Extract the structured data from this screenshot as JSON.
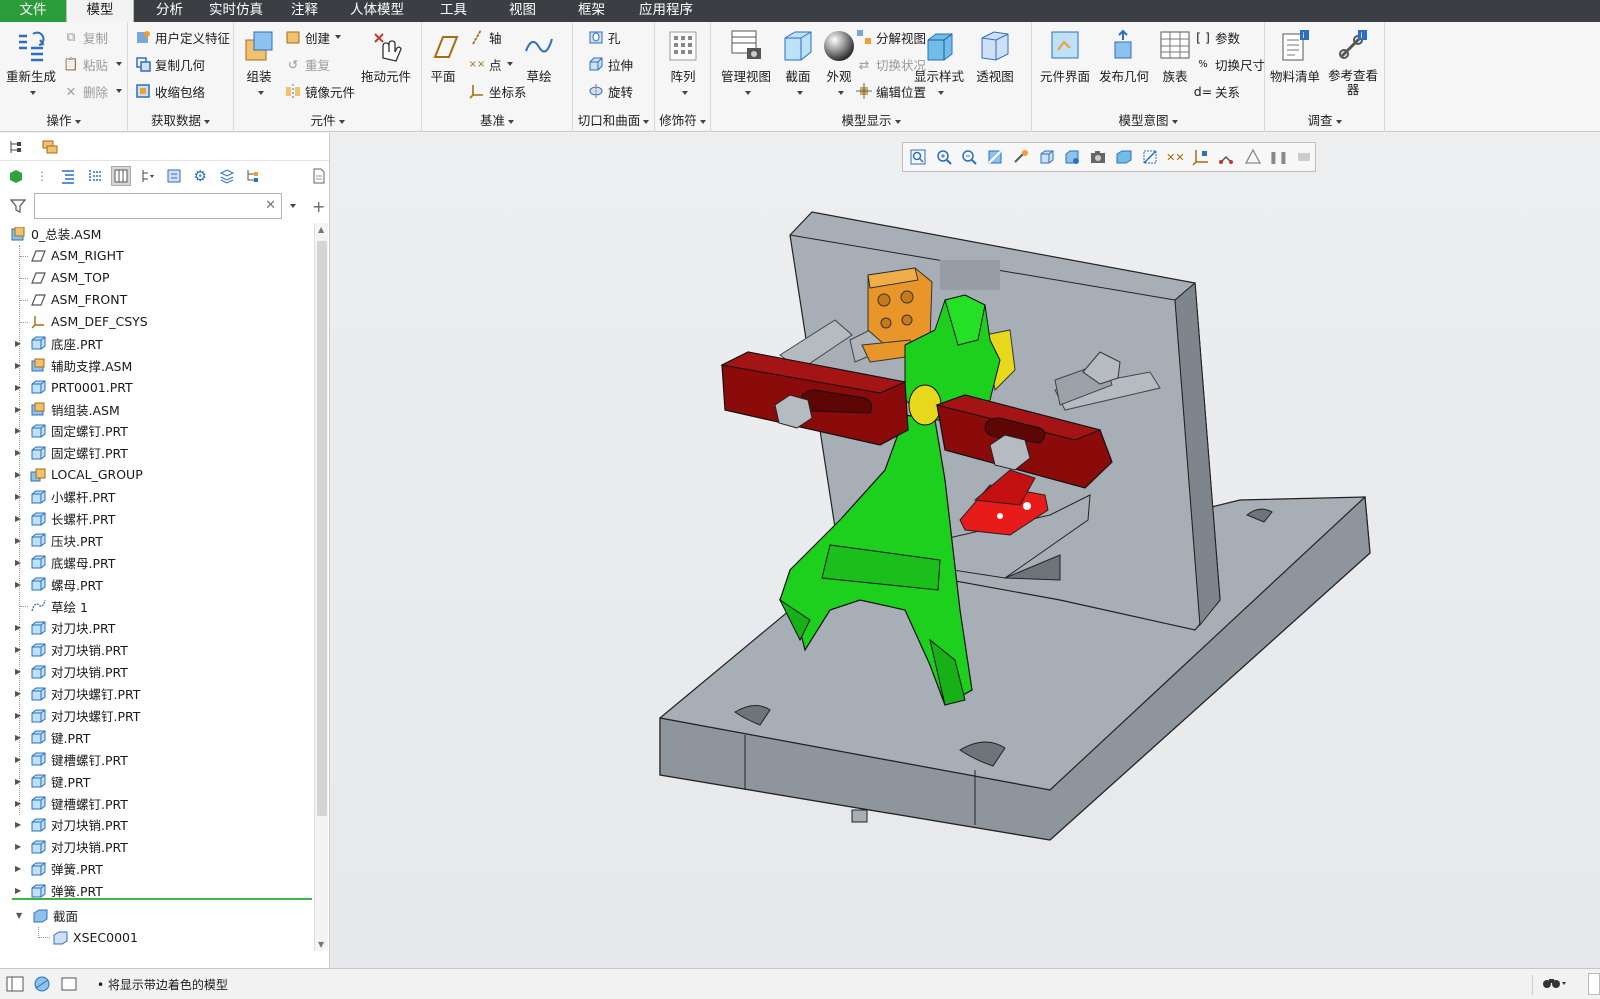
{
  "menu": {
    "file": "文件",
    "items": [
      "模型",
      "分析",
      "实时仿真",
      "注释",
      "人体模型",
      "工具",
      "视图",
      "框架",
      "应用程序"
    ]
  },
  "ribbon": {
    "operations": {
      "label": "操作",
      "regenerate": "重新生成",
      "copy": "复制",
      "paste": "粘贴",
      "delete": "删除"
    },
    "get_data": {
      "label": "获取数据",
      "udf": "用户定义特征",
      "copy_geom": "复制几何",
      "shrinkwrap": "收缩包络"
    },
    "component": {
      "label": "元件",
      "assemble": "组装",
      "create": "创建",
      "redo": "重复",
      "mirror": "镜像元件",
      "drag": "拖动元件"
    },
    "datum": {
      "label": "基准",
      "plane": "平面",
      "axis": "轴",
      "point": "点",
      "csys": "坐标系",
      "sketch": "草绘"
    },
    "cut_surface": {
      "label": "切口和曲面",
      "hole": "孔",
      "extrude": "拉伸",
      "revolve": "旋转"
    },
    "modifiers": {
      "label": "修饰符",
      "pattern": "阵列"
    },
    "model_display": {
      "label": "模型显示",
      "manage_views": "管理视图",
      "section": "截面",
      "appearance": "外观",
      "explode": "分解视图",
      "toggle_status": "切换状况",
      "edit_position": "编辑位置",
      "display_style": "显示样式",
      "perspective": "透视图"
    },
    "model_intent": {
      "label": "模型意图",
      "component_interface": "元件界面",
      "publish_geom": "发布几何",
      "family_table": "族表",
      "params": "参数",
      "switch_dims": "切换尺寸",
      "relations": "关系"
    },
    "investigate": {
      "label": "调查",
      "bom": "物料清单",
      "ref_viewer": "参考查看器"
    }
  },
  "model_tree": {
    "filter_placeholder": "",
    "root": "0_总装.ASM",
    "items": [
      {
        "name": "ASM_RIGHT",
        "icon": "datum-plane-icon",
        "expandable": false
      },
      {
        "name": "ASM_TOP",
        "icon": "datum-plane-icon",
        "expandable": false
      },
      {
        "name": "ASM_FRONT",
        "icon": "datum-plane-icon",
        "expandable": false
      },
      {
        "name": "ASM_DEF_CSYS",
        "icon": "csys-icon",
        "expandable": false
      },
      {
        "name": "底座.PRT",
        "icon": "part-icon",
        "expandable": true
      },
      {
        "name": "辅助支撑.ASM",
        "icon": "assembly-icon",
        "expandable": true
      },
      {
        "name": "PRT0001.PRT",
        "icon": "part-icon",
        "expandable": true
      },
      {
        "name": "销组装.ASM",
        "icon": "assembly-icon",
        "expandable": true
      },
      {
        "name": "固定螺钉.PRT",
        "icon": "part-icon",
        "expandable": true
      },
      {
        "name": "固定螺钉.PRT",
        "icon": "part-icon",
        "expandable": true
      },
      {
        "name": "LOCAL_GROUP",
        "icon": "group-icon",
        "expandable": true
      },
      {
        "name": "小螺杆.PRT",
        "icon": "part-icon",
        "expandable": true
      },
      {
        "name": "长螺杆.PRT",
        "icon": "part-icon",
        "expandable": true
      },
      {
        "name": "压块.PRT",
        "icon": "part-icon",
        "expandable": true
      },
      {
        "name": "底螺母.PRT",
        "icon": "part-icon",
        "expandable": true
      },
      {
        "name": "螺母.PRT",
        "icon": "part-icon",
        "expandable": true
      },
      {
        "name": "草绘 1",
        "icon": "sketch-icon",
        "expandable": false
      },
      {
        "name": "对刀块.PRT",
        "icon": "part-icon",
        "expandable": true
      },
      {
        "name": "对刀块销.PRT",
        "icon": "part-icon",
        "expandable": true
      },
      {
        "name": "对刀块销.PRT",
        "icon": "part-icon",
        "expandable": true
      },
      {
        "name": "对刀块螺钉.PRT",
        "icon": "part-icon",
        "expandable": true
      },
      {
        "name": "对刀块螺钉.PRT",
        "icon": "part-icon",
        "expandable": true
      },
      {
        "name": "键.PRT",
        "icon": "part-icon",
        "expandable": true
      },
      {
        "name": "键槽螺钉.PRT",
        "icon": "part-icon",
        "expandable": true
      },
      {
        "name": "键.PRT",
        "icon": "part-icon",
        "expandable": true
      },
      {
        "name": "键槽螺钉.PRT",
        "icon": "part-icon",
        "expandable": true
      },
      {
        "name": "对刀块销.PRT",
        "icon": "part-icon",
        "expandable": true
      },
      {
        "name": "对刀块销.PRT",
        "icon": "part-icon",
        "expandable": true
      },
      {
        "name": "弹簧.PRT",
        "icon": "part-icon",
        "expandable": true
      },
      {
        "name": "弹簧.PRT",
        "icon": "part-icon",
        "expandable": true
      }
    ],
    "sections_header": "截面",
    "sections": [
      "XSEC0001"
    ]
  },
  "status": {
    "message": "将显示带边着色的模型"
  },
  "colors": {
    "accent": "#2a9d3a",
    "menubar": "#3b3f43",
    "part_gray": "#a7aeb5",
    "part_green": "#1ed01e",
    "part_red": "#8b0a0a",
    "part_orange": "#e8952a"
  }
}
